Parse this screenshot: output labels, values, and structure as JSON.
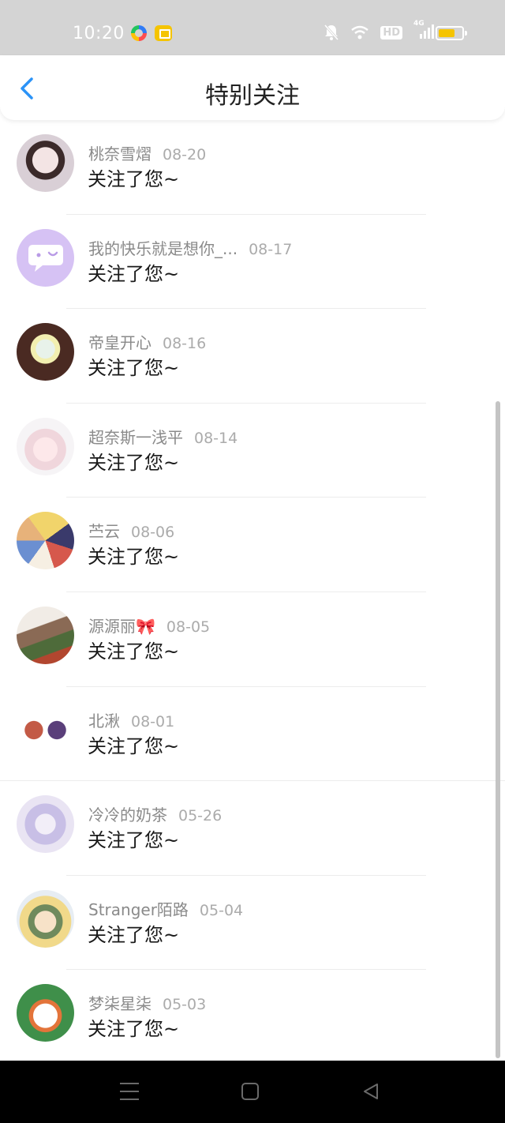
{
  "status_bar": {
    "time": "10:20",
    "hd_label": "HD",
    "network_label": "4G",
    "icons": [
      "colorful-app-icon",
      "yellow-app-icon",
      "bell-muted-icon",
      "wifi-icon",
      "signal-icon",
      "battery-icon"
    ],
    "battery_color": "#f5c400"
  },
  "header": {
    "title": "特别关注",
    "back_icon": "chevron-left-icon",
    "accent": "#2b93f7"
  },
  "items": [
    {
      "name": "桃奈雪熠",
      "date": "08-20",
      "message": "关注了您~"
    },
    {
      "name": "我的快乐就是想你_...",
      "date": "08-17",
      "message": "关注了您~"
    },
    {
      "name": "帝皇开心",
      "date": "08-16",
      "message": "关注了您~"
    },
    {
      "name": "超奈斯一浅平",
      "date": "08-14",
      "message": "关注了您~"
    },
    {
      "name": "苎云",
      "date": "08-06",
      "message": "关注了您~"
    },
    {
      "name": "源源丽🎀",
      "date": "08-05",
      "message": "关注了您~"
    },
    {
      "name": "北湫",
      "date": "08-01",
      "message": "关注了您~"
    },
    {
      "name": "冷冷的奶茶",
      "date": "05-26",
      "message": "关注了您~"
    },
    {
      "name": "Stranger陌路",
      "date": "05-04",
      "message": "关注了您~"
    },
    {
      "name": "梦柒星柒",
      "date": "05-03",
      "message": "关注了您~"
    }
  ],
  "nav_bar": {
    "icons": [
      "menu-icon",
      "home-icon",
      "back-triangle-icon"
    ]
  }
}
